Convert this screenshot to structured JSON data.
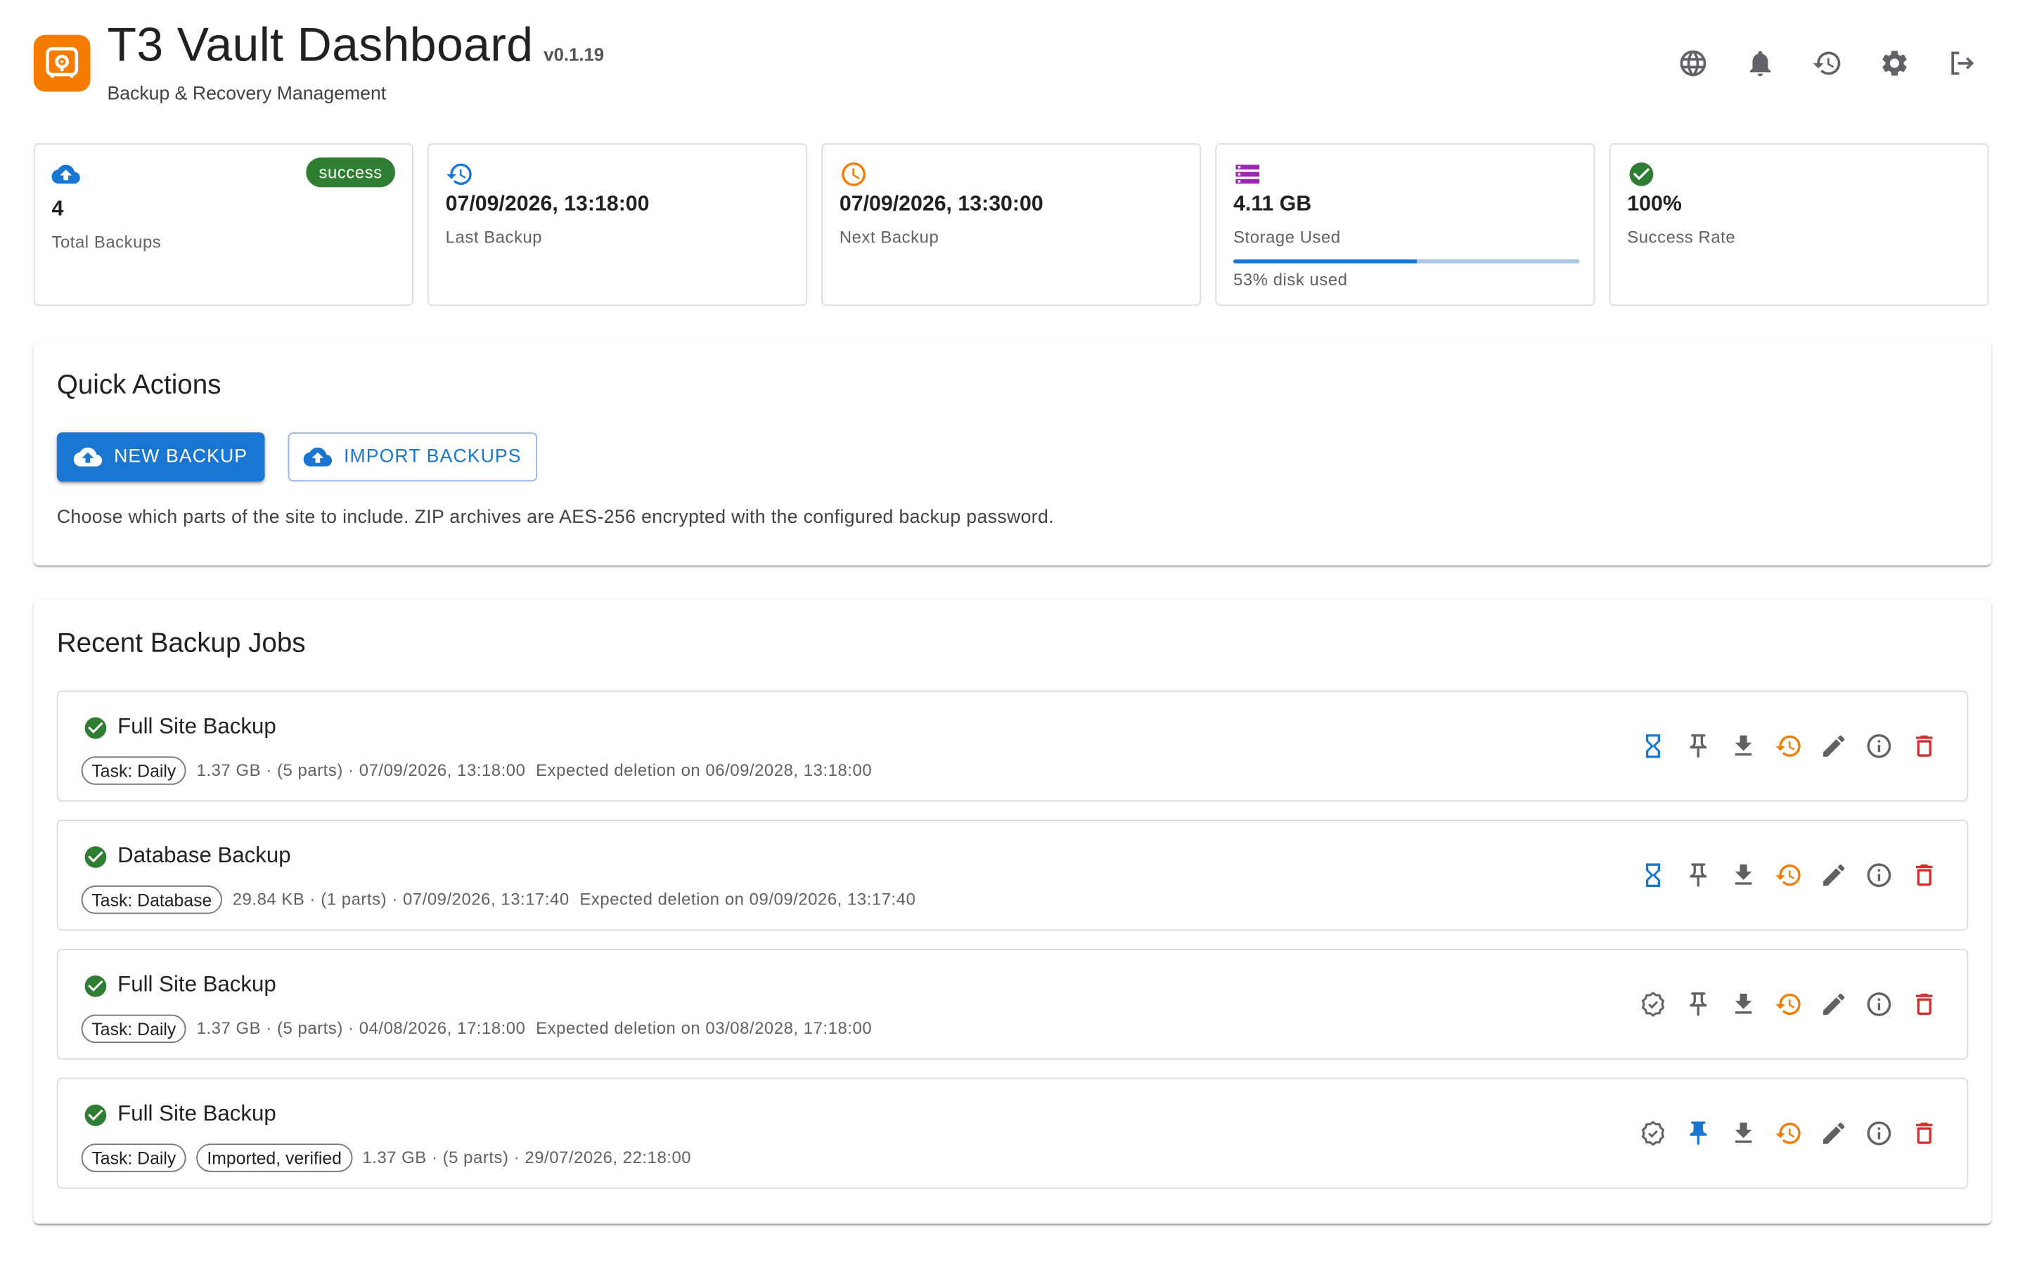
{
  "header": {
    "title": "T3 Vault Dashboard",
    "version": "v0.1.19",
    "subtitle": "Backup & Recovery Management",
    "icons": [
      "globe-icon",
      "bell-icon",
      "history-icon",
      "gear-icon",
      "logout-icon"
    ]
  },
  "stats": [
    {
      "icon": "cloud-upload-icon",
      "value": "4",
      "label": "Total Backups",
      "badge": "success",
      "color": "#1976d2"
    },
    {
      "icon": "history-icon",
      "value": "07/09/2026, 13:18:00",
      "label": "Last Backup",
      "color": "#1976d2"
    },
    {
      "icon": "clock-icon",
      "value": "07/09/2026, 13:30:00",
      "label": "Next Backup",
      "color": "#f57c00"
    },
    {
      "icon": "storage-icon",
      "value": "4.11 GB",
      "label": "Storage Used",
      "progress_percent": 53,
      "progress_label": "53% disk used",
      "color": "#9c27b0"
    },
    {
      "icon": "check-circle-icon",
      "value": "100%",
      "label": "Success Rate",
      "color": "#2e7d32"
    }
  ],
  "quick_actions": {
    "title": "Quick Actions",
    "new_backup_label": "NEW BACKUP",
    "import_label": "IMPORT BACKUPS",
    "description": "Choose which parts of the site to include. ZIP archives are AES-256 encrypted with the configured backup password."
  },
  "jobs": {
    "title": "Recent Backup Jobs",
    "items": [
      {
        "title": "Full Site Backup",
        "chips": [
          "Task: Daily"
        ],
        "details": "1.37 GB · (5 parts) · 07/09/2026, 13:18:00",
        "expiry": "Expected deletion on 06/09/2028, 13:18:00",
        "retention_icon": "hourglass-icon",
        "pinned": false
      },
      {
        "title": "Database Backup",
        "chips": [
          "Task: Database"
        ],
        "details": "29.84 KB · (1 parts) · 07/09/2026, 13:17:40",
        "expiry": "Expected deletion on 09/09/2026, 13:17:40",
        "retention_icon": "hourglass-icon",
        "pinned": false
      },
      {
        "title": "Full Site Backup",
        "chips": [
          "Task: Daily"
        ],
        "details": "1.37 GB · (5 parts) · 04/08/2026, 17:18:00",
        "expiry": "Expected deletion on 03/08/2028, 17:18:00",
        "retention_icon": "verified-icon",
        "pinned": false
      },
      {
        "title": "Full Site Backup",
        "chips": [
          "Task: Daily",
          "Imported, verified"
        ],
        "details": "1.37 GB · (5 parts) · 29/07/2026, 22:18:00",
        "expiry": "",
        "retention_icon": "verified-icon",
        "pinned": true
      }
    ]
  },
  "colors": {
    "primary": "#1976d2",
    "success": "#2e7d32",
    "warning": "#f57c00",
    "danger": "#d32f2f",
    "purple": "#9c27b0",
    "icon_grey": "#616161"
  }
}
